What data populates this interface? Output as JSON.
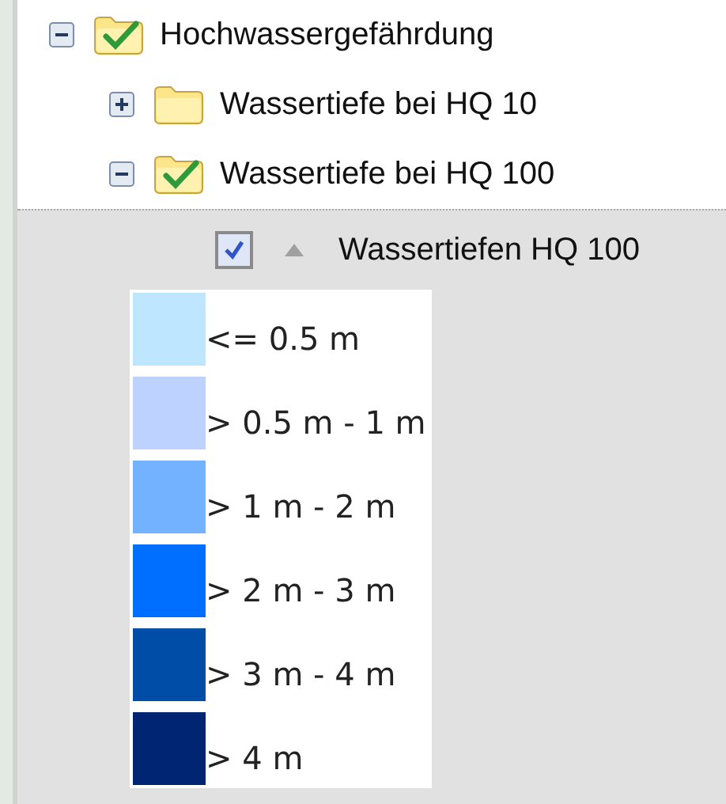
{
  "tree": [
    {
      "kind": "group",
      "label": "Hochwassergefährdung",
      "expanded": true,
      "checked": true,
      "children": [
        {
          "kind": "group",
          "label": "Wassertiefe bei HQ 10",
          "expanded": false,
          "checked": false
        },
        {
          "kind": "group",
          "label": "Wassertiefe bei HQ 100",
          "expanded": true,
          "checked": true,
          "children": [
            {
              "kind": "layer",
              "label": "Wassertiefen HQ 100",
              "checked": true,
              "selected": true,
              "legend": [
                {
                  "label": "<= 0.5 m",
                  "color": "#bee6ff"
                },
                {
                  "label": "> 0.5 m - 1 m",
                  "color": "#bed2ff"
                },
                {
                  "label": "> 1 m - 2 m",
                  "color": "#73b2ff"
                },
                {
                  "label": "> 2 m - 3 m",
                  "color": "#006eff"
                },
                {
                  "label": "> 3 m - 4 m",
                  "color": "#004da8"
                },
                {
                  "label": "> 4 m",
                  "color": "#002673"
                }
              ]
            }
          ]
        }
      ]
    }
  ]
}
